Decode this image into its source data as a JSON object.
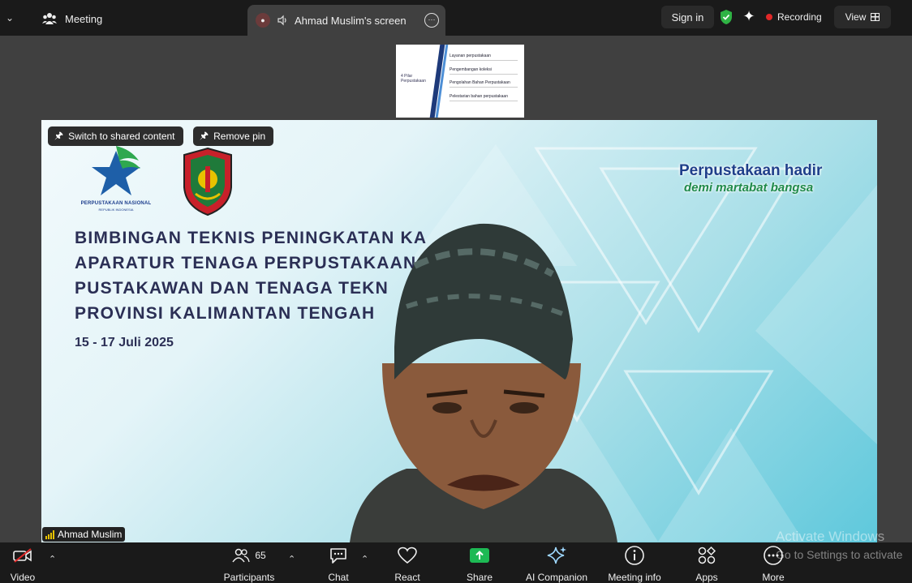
{
  "topbar": {
    "meeting_label": "Meeting",
    "screen_tab_label": "Ahmad Muslim's screen",
    "sign_in_label": "Sign in",
    "recording_label": "Recording",
    "view_label": "View"
  },
  "thumbnail": {
    "left_label": "4 Pilar Perpustakaan",
    "items": [
      "Layanan perpustakaan",
      "Pengembangan koleksi",
      "Pengolahan Bahan Perpustakaan",
      "Pelestarian bahan perpustakaan"
    ]
  },
  "stage": {
    "switch_button_label": "Switch to shared content",
    "remove_pin_label": "Remove pin",
    "logo_name": "PERPUSTAKAAN NASIONAL",
    "logo_sub": "REPUBLIK INDONESIA",
    "title_lines": [
      "BIMBINGAN TEKNIS PENINGKATAN KA",
      "APARATUR TENAGA PERPUSTAKAAN",
      "PUSTAKAWAN DAN TENAGA TEKN",
      "PROVINSI KALIMANTAN TENGAH"
    ],
    "date": "15 - 17 Juli 2025",
    "slogan_main": "Perpustakaan hadir",
    "slogan_sub": "demi martabat bangsa",
    "participant_name": "Ahmad Muslim"
  },
  "watermark": {
    "line1": "Activate Windows",
    "line2": "Go to Settings to activate"
  },
  "toolbar": {
    "video_label": "Video",
    "participants_label": "Participants",
    "participants_count": "65",
    "chat_label": "Chat",
    "react_label": "React",
    "share_label": "Share",
    "ai_label": "AI Companion",
    "info_label": "Meeting info",
    "apps_label": "Apps",
    "more_label": "More"
  },
  "colors": {
    "share_green": "#1db954",
    "recording_red": "#e02828",
    "title_navy": "#2b2f55",
    "slogan_blue": "#1e3f8a",
    "slogan_green": "#1f8a4a"
  }
}
